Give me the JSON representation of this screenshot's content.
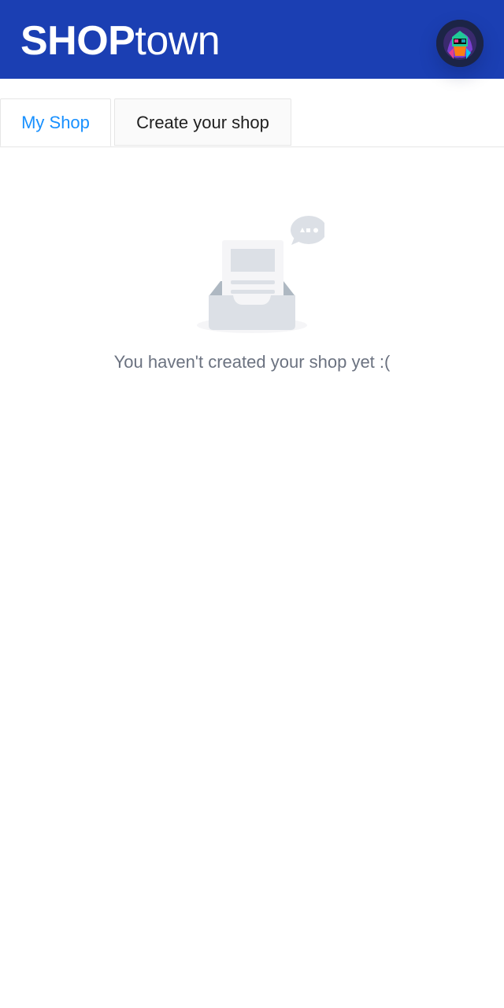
{
  "header": {
    "brand_bold": "SHOP",
    "brand_light": "town",
    "brand_color": "#1b3fb3"
  },
  "tabs": [
    {
      "label": "My Shop",
      "active": true,
      "color": "#1890ff"
    },
    {
      "label": "Create your shop",
      "active": false
    }
  ],
  "empty_state": {
    "icon": "empty-inbox-icon",
    "message": "You haven't created your shop yet :("
  },
  "user": {
    "avatar_icon": "avatar-icon"
  }
}
